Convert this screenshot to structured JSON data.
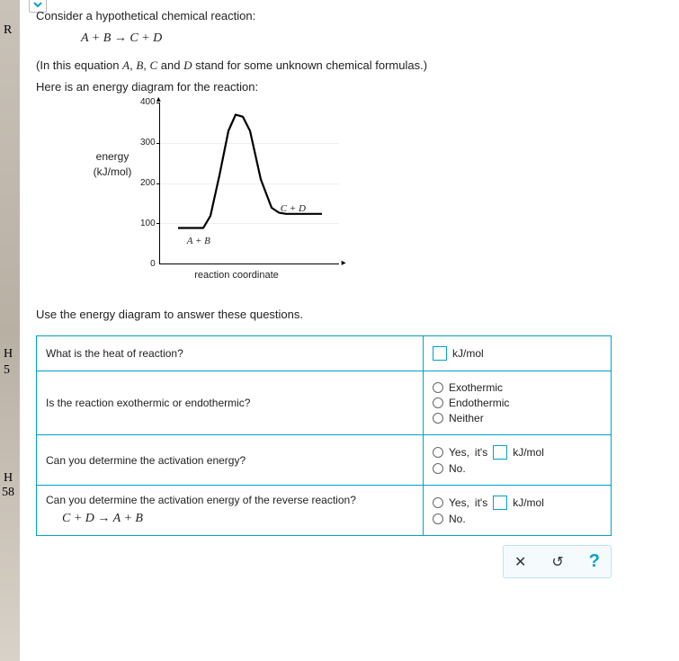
{
  "sliver": {
    "l1": "R",
    "l2": "H",
    "l3": "5",
    "l4": "H",
    "l5": "58"
  },
  "prompt": {
    "intro": "Consider a hypothetical chemical reaction:",
    "equation_lhs": "A + B",
    "arrow": "→",
    "equation_rhs": "C + D",
    "paren_pre": "(In this equation ",
    "var_a": "A",
    "var_b": "B",
    "var_c": "C",
    "var_d": "D",
    "paren_mid1": ", ",
    "paren_mid2": ", ",
    "paren_mid3": " and ",
    "paren_post": " stand for some unknown chemical formulas.)",
    "diagram_intro": "Here is an energy diagram for the reaction:",
    "subhead": "Use the energy diagram to answer these questions."
  },
  "chart_data": {
    "type": "line",
    "xlabel": "reaction coordinate",
    "ylabel_line1": "energy",
    "ylabel_line2": "(kJ/mol)",
    "ylim": [
      0,
      400
    ],
    "yticks": [
      0,
      100,
      200,
      300,
      400
    ],
    "annotations": {
      "reactants": "A  +  B",
      "products": "C  +  D"
    },
    "series": [
      {
        "name": "energy",
        "x_norm": [
          0.1,
          0.24,
          0.28,
          0.33,
          0.38,
          0.42,
          0.46,
          0.5,
          0.56,
          0.62,
          0.66,
          0.7,
          0.9
        ],
        "y": [
          90,
          90,
          120,
          220,
          330,
          370,
          365,
          330,
          210,
          140,
          128,
          125,
          125
        ]
      }
    ],
    "levels": {
      "reactants": 90,
      "transition": 370,
      "products": 125
    }
  },
  "questions": {
    "q1": "What is the heat of reaction?",
    "q2": "Is the reaction exothermic or endothermic?",
    "q3": "Can you determine the activation energy?",
    "q4": "Can you determine the activation energy of the reverse reaction?",
    "q4_eq_lhs": "C + D",
    "q4_eq_arrow": "→",
    "q4_eq_rhs": "A + B"
  },
  "answers": {
    "unit": "kJ/mol",
    "q2_opts": [
      "Exothermic",
      "Endothermic",
      "Neither"
    ],
    "yes_pre": "Yes,",
    "yes_mid": "it's",
    "no": "No."
  },
  "toolbar": {
    "close": "✕",
    "reset": "↺",
    "help": "?"
  }
}
